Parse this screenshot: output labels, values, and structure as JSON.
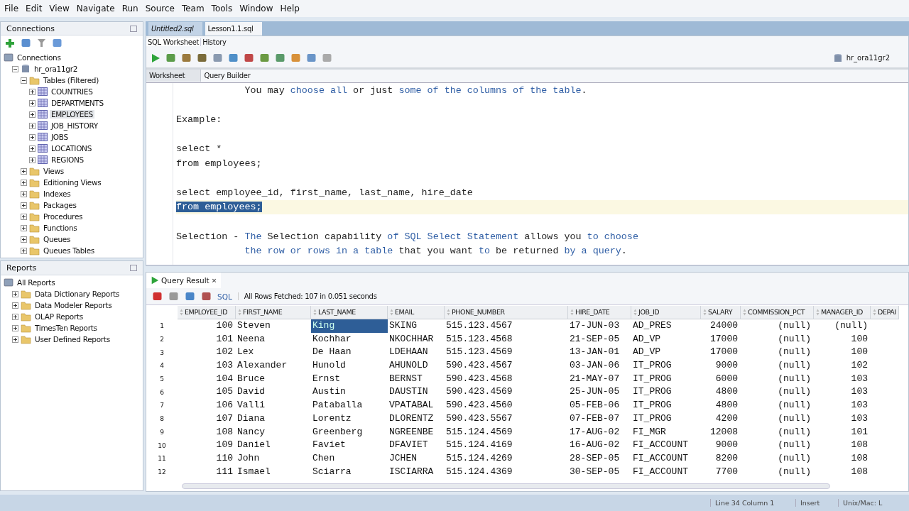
{
  "menu": [
    "File",
    "Edit",
    "View",
    "Navigate",
    "Run",
    "Source",
    "Team",
    "Tools",
    "Window",
    "Help"
  ],
  "connections_panel": {
    "title": "Connections",
    "tree": [
      {
        "label": "Connections",
        "kind": "connection",
        "children": [
          {
            "label": "hr_ora11gr2",
            "kind": "database",
            "expanded": true,
            "children": [
              {
                "label": "Tables (Filtered)",
                "kind": "folder",
                "expanded": true,
                "children": [
                  {
                    "label": "COUNTRIES",
                    "kind": "table",
                    "expanded": false,
                    "selected": false
                  },
                  {
                    "label": "DEPARTMENTS",
                    "kind": "table",
                    "expanded": false,
                    "selected": false
                  },
                  {
                    "label": "EMPLOYEES",
                    "kind": "table",
                    "expanded": false,
                    "selected": true
                  },
                  {
                    "label": "JOB_HISTORY",
                    "kind": "table",
                    "expanded": false,
                    "selected": false
                  },
                  {
                    "label": "JOBS",
                    "kind": "table",
                    "expanded": false,
                    "selected": false
                  },
                  {
                    "label": "LOCATIONS",
                    "kind": "table",
                    "expanded": false,
                    "selected": false
                  },
                  {
                    "label": "REGIONS",
                    "kind": "table",
                    "expanded": false,
                    "selected": false
                  }
                ]
              },
              {
                "label": "Views",
                "kind": "folder",
                "expanded": false
              },
              {
                "label": "Editioning Views",
                "kind": "folder",
                "expanded": false
              },
              {
                "label": "Indexes",
                "kind": "folder",
                "expanded": false
              },
              {
                "label": "Packages",
                "kind": "folder",
                "expanded": false
              },
              {
                "label": "Procedures",
                "kind": "folder",
                "expanded": false
              },
              {
                "label": "Functions",
                "kind": "folder",
                "expanded": false
              },
              {
                "label": "Queues",
                "kind": "folder",
                "expanded": false
              },
              {
                "label": "Queues Tables",
                "kind": "folder",
                "expanded": false
              }
            ]
          }
        ]
      }
    ]
  },
  "reports_panel": {
    "title": "Reports",
    "tree": [
      {
        "label": "All Reports",
        "kind": "connection",
        "children": [
          {
            "label": "Data Dictionary Reports",
            "kind": "folder",
            "expanded": false
          },
          {
            "label": "Data Modeler Reports",
            "kind": "folder",
            "expanded": false
          },
          {
            "label": "OLAP Reports",
            "kind": "folder",
            "expanded": false
          },
          {
            "label": "TimesTen Reports",
            "kind": "folder",
            "expanded": false
          },
          {
            "label": "User Defined Reports",
            "kind": "folder",
            "expanded": false
          }
        ]
      }
    ]
  },
  "file_tabs": [
    {
      "label": "Untitled2.sql",
      "selected": false
    },
    {
      "label": "Lesson1.1.sql",
      "selected": true
    }
  ],
  "view_tabs": [
    {
      "label": "SQL Worksheet",
      "selected": true
    },
    {
      "label": "History",
      "selected": false
    }
  ],
  "connection_selector": "hr_ora11gr2",
  "worksheet_tabs": [
    {
      "label": "Worksheet",
      "selected": true
    },
    {
      "label": "Query Builder",
      "selected": false
    }
  ],
  "editor_lines": [
    {
      "kind": "text",
      "selected": false,
      "segments": [
        {
          "text": "            You may ",
          "kind": "plain"
        },
        {
          "text": "choose all",
          "kind": "keyword"
        },
        {
          "text": " or just ",
          "kind": "plain"
        },
        {
          "text": "some of the columns of the table",
          "kind": "keyword"
        },
        {
          "text": ".",
          "kind": "plain"
        }
      ]
    },
    {
      "kind": "blank"
    },
    {
      "kind": "text",
      "selected": false,
      "segments": [
        {
          "text": "Example:",
          "kind": "plain"
        }
      ]
    },
    {
      "kind": "blank"
    },
    {
      "kind": "text",
      "selected": false,
      "segments": [
        {
          "text": "select *",
          "kind": "plain"
        }
      ]
    },
    {
      "kind": "text",
      "selected": false,
      "segments": [
        {
          "text": "from employees;",
          "kind": "plain"
        }
      ]
    },
    {
      "kind": "blank"
    },
    {
      "kind": "text",
      "selected": false,
      "segments": [
        {
          "text": "select employee_id, first_name, last_name, hire_date",
          "kind": "plain"
        }
      ]
    },
    {
      "kind": "text",
      "selected": true,
      "segments": [
        {
          "text": "from employees;",
          "kind": "plain"
        }
      ]
    },
    {
      "kind": "blank"
    },
    {
      "kind": "text",
      "selected": false,
      "segments": [
        {
          "text": "Selection - ",
          "kind": "plain"
        },
        {
          "text": "The",
          "kind": "keyword"
        },
        {
          "text": " Selection capability ",
          "kind": "plain"
        },
        {
          "text": "of SQL Select Statement",
          "kind": "keyword"
        },
        {
          "text": " allows you ",
          "kind": "plain"
        },
        {
          "text": "to choose",
          "kind": "keyword"
        }
      ]
    },
    {
      "kind": "text",
      "selected": false,
      "segments": [
        {
          "text": "            the row or rows in a table",
          "kind": "keyword"
        },
        {
          "text": " that you want ",
          "kind": "plain"
        },
        {
          "text": "to",
          "kind": "keyword"
        },
        {
          "text": " be returned ",
          "kind": "plain"
        },
        {
          "text": "by a query",
          "kind": "keyword"
        },
        {
          "text": ".",
          "kind": "plain"
        }
      ]
    }
  ],
  "result": {
    "tab": "Query Result",
    "close_glyph": "×",
    "sql_label": "SQL",
    "status": "All Rows Fetched: 107 in 0.051 seconds",
    "columns": [
      {
        "label": "EMPLOYEE_ID",
        "kind": "number"
      },
      {
        "label": "FIRST_NAME",
        "kind": "text"
      },
      {
        "label": "LAST_NAME",
        "kind": "text"
      },
      {
        "label": "EMAIL",
        "kind": "text"
      },
      {
        "label": "PHONE_NUMBER",
        "kind": "text"
      },
      {
        "label": "HIRE_DATE",
        "kind": "text"
      },
      {
        "label": "JOB_ID",
        "kind": "text"
      },
      {
        "label": "SALARY",
        "kind": "number"
      },
      {
        "label": "COMMISSION_PCT",
        "kind": "number"
      },
      {
        "label": "MANAGER_ID",
        "kind": "number"
      },
      {
        "label": "DEPAI"
      }
    ],
    "rows": [
      {
        "num": "1",
        "cells": [
          {
            "text": "100",
            "selected": false
          },
          {
            "text": "Steven",
            "selected": false
          },
          {
            "text": "King",
            "selected": true
          },
          {
            "text": "SKING",
            "selected": false
          },
          {
            "text": "515.123.4567",
            "selected": false
          },
          {
            "text": "17-JUN-03",
            "selected": false
          },
          {
            "text": "AD_PRES",
            "selected": false
          },
          {
            "text": "24000",
            "selected": false
          },
          {
            "text": "(null)",
            "selected": false
          },
          {
            "text": "(null)",
            "selected": false
          }
        ]
      },
      {
        "num": "2",
        "cells": [
          {
            "text": "101",
            "selected": false
          },
          {
            "text": "Neena",
            "selected": false
          },
          {
            "text": "Kochhar",
            "selected": false
          },
          {
            "text": "NKOCHHAR",
            "selected": false
          },
          {
            "text": "515.123.4568",
            "selected": false
          },
          {
            "text": "21-SEP-05",
            "selected": false
          },
          {
            "text": "AD_VP",
            "selected": false
          },
          {
            "text": "17000",
            "selected": false
          },
          {
            "text": "(null)",
            "selected": false
          },
          {
            "text": "100",
            "selected": false
          }
        ]
      },
      {
        "num": "3",
        "cells": [
          {
            "text": "102",
            "selected": false
          },
          {
            "text": "Lex",
            "selected": false
          },
          {
            "text": "De Haan",
            "selected": false
          },
          {
            "text": "LDEHAAN",
            "selected": false
          },
          {
            "text": "515.123.4569",
            "selected": false
          },
          {
            "text": "13-JAN-01",
            "selected": false
          },
          {
            "text": "AD_VP",
            "selected": false
          },
          {
            "text": "17000",
            "selected": false
          },
          {
            "text": "(null)",
            "selected": false
          },
          {
            "text": "100",
            "selected": false
          }
        ]
      },
      {
        "num": "4",
        "cells": [
          {
            "text": "103",
            "selected": false
          },
          {
            "text": "Alexander",
            "selected": false
          },
          {
            "text": "Hunold",
            "selected": false
          },
          {
            "text": "AHUNOLD",
            "selected": false
          },
          {
            "text": "590.423.4567",
            "selected": false
          },
          {
            "text": "03-JAN-06",
            "selected": false
          },
          {
            "text": "IT_PROG",
            "selected": false
          },
          {
            "text": "9000",
            "selected": false
          },
          {
            "text": "(null)",
            "selected": false
          },
          {
            "text": "102",
            "selected": false
          }
        ]
      },
      {
        "num": "5",
        "cells": [
          {
            "text": "104",
            "selected": false
          },
          {
            "text": "Bruce",
            "selected": false
          },
          {
            "text": "Ernst",
            "selected": false
          },
          {
            "text": "BERNST",
            "selected": false
          },
          {
            "text": "590.423.4568",
            "selected": false
          },
          {
            "text": "21-MAY-07",
            "selected": false
          },
          {
            "text": "IT_PROG",
            "selected": false
          },
          {
            "text": "6000",
            "selected": false
          },
          {
            "text": "(null)",
            "selected": false
          },
          {
            "text": "103",
            "selected": false
          }
        ]
      },
      {
        "num": "6",
        "cells": [
          {
            "text": "105",
            "selected": false
          },
          {
            "text": "David",
            "selected": false
          },
          {
            "text": "Austin",
            "selected": false
          },
          {
            "text": "DAUSTIN",
            "selected": false
          },
          {
            "text": "590.423.4569",
            "selected": false
          },
          {
            "text": "25-JUN-05",
            "selected": false
          },
          {
            "text": "IT_PROG",
            "selected": false
          },
          {
            "text": "4800",
            "selected": false
          },
          {
            "text": "(null)",
            "selected": false
          },
          {
            "text": "103",
            "selected": false
          }
        ]
      },
      {
        "num": "7",
        "cells": [
          {
            "text": "106",
            "selected": false
          },
          {
            "text": "Valli",
            "selected": false
          },
          {
            "text": "Pataballa",
            "selected": false
          },
          {
            "text": "VPATABAL",
            "selected": false
          },
          {
            "text": "590.423.4560",
            "selected": false
          },
          {
            "text": "05-FEB-06",
            "selected": false
          },
          {
            "text": "IT_PROG",
            "selected": false
          },
          {
            "text": "4800",
            "selected": false
          },
          {
            "text": "(null)",
            "selected": false
          },
          {
            "text": "103",
            "selected": false
          }
        ]
      },
      {
        "num": "8",
        "cells": [
          {
            "text": "107",
            "selected": false
          },
          {
            "text": "Diana",
            "selected": false
          },
          {
            "text": "Lorentz",
            "selected": false
          },
          {
            "text": "DLORENTZ",
            "selected": false
          },
          {
            "text": "590.423.5567",
            "selected": false
          },
          {
            "text": "07-FEB-07",
            "selected": false
          },
          {
            "text": "IT_PROG",
            "selected": false
          },
          {
            "text": "4200",
            "selected": false
          },
          {
            "text": "(null)",
            "selected": false
          },
          {
            "text": "103",
            "selected": false
          }
        ]
      },
      {
        "num": "9",
        "cells": [
          {
            "text": "108",
            "selected": false
          },
          {
            "text": "Nancy",
            "selected": false
          },
          {
            "text": "Greenberg",
            "selected": false
          },
          {
            "text": "NGREENBE",
            "selected": false
          },
          {
            "text": "515.124.4569",
            "selected": false
          },
          {
            "text": "17-AUG-02",
            "selected": false
          },
          {
            "text": "FI_MGR",
            "selected": false
          },
          {
            "text": "12008",
            "selected": false
          },
          {
            "text": "(null)",
            "selected": false
          },
          {
            "text": "101",
            "selected": false
          }
        ]
      },
      {
        "num": "10",
        "cells": [
          {
            "text": "109",
            "selected": false
          },
          {
            "text": "Daniel",
            "selected": false
          },
          {
            "text": "Faviet",
            "selected": false
          },
          {
            "text": "DFAVIET",
            "selected": false
          },
          {
            "text": "515.124.4169",
            "selected": false
          },
          {
            "text": "16-AUG-02",
            "selected": false
          },
          {
            "text": "FI_ACCOUNT",
            "selected": false
          },
          {
            "text": "9000",
            "selected": false
          },
          {
            "text": "(null)",
            "selected": false
          },
          {
            "text": "108",
            "selected": false
          }
        ]
      },
      {
        "num": "11",
        "cells": [
          {
            "text": "110",
            "selected": false
          },
          {
            "text": "John",
            "selected": false
          },
          {
            "text": "Chen",
            "selected": false
          },
          {
            "text": "JCHEN",
            "selected": false
          },
          {
            "text": "515.124.4269",
            "selected": false
          },
          {
            "text": "28-SEP-05",
            "selected": false
          },
          {
            "text": "FI_ACCOUNT",
            "selected": false
          },
          {
            "text": "8200",
            "selected": false
          },
          {
            "text": "(null)",
            "selected": false
          },
          {
            "text": "108",
            "selected": false
          }
        ]
      },
      {
        "num": "12",
        "cells": [
          {
            "text": "111",
            "selected": false
          },
          {
            "text": "Ismael",
            "selected": false
          },
          {
            "text": "Sciarra",
            "selected": false
          },
          {
            "text": "ISCIARRA",
            "selected": false
          },
          {
            "text": "515.124.4369",
            "selected": false
          },
          {
            "text": "30-SEP-05",
            "selected": false
          },
          {
            "text": "FI_ACCOUNT",
            "selected": false
          },
          {
            "text": "7700",
            "selected": false
          },
          {
            "text": "(null)",
            "selected": false
          },
          {
            "text": "108",
            "selected": false
          }
        ]
      }
    ]
  },
  "status_bar": [
    "Line 34 Column 1",
    "Insert",
    "Unix/Mac: L"
  ]
}
